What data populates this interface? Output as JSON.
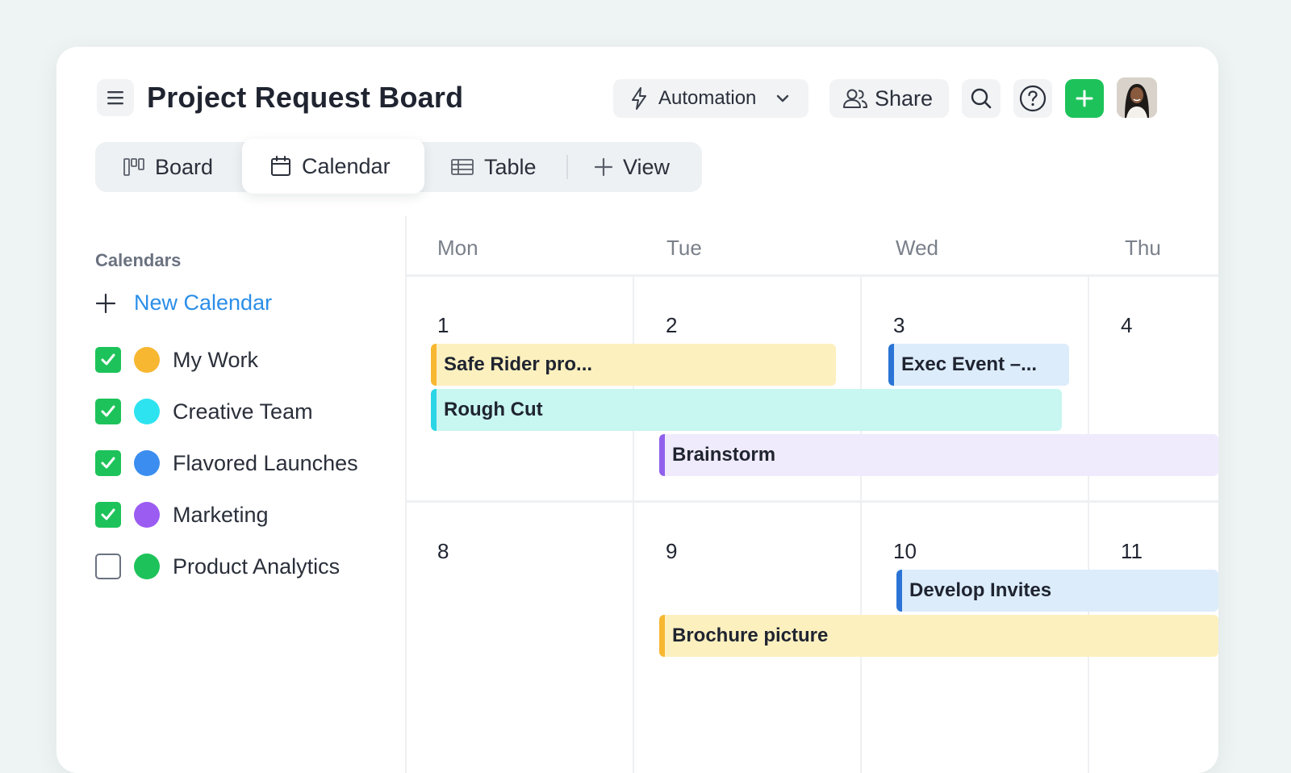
{
  "header": {
    "title": "Project Request Board",
    "automation_label": "Automation",
    "share_label": "Share"
  },
  "tabs": [
    {
      "label": "Board",
      "icon": "board-icon"
    },
    {
      "label": "Calendar",
      "icon": "calendar-icon",
      "active": true
    },
    {
      "label": "Table",
      "icon": "table-icon"
    },
    {
      "label": "View",
      "icon": "plus-icon"
    }
  ],
  "sidebar": {
    "heading": "Calendars",
    "new_calendar_label": "New Calendar",
    "items": [
      {
        "label": "My Work",
        "checked": true,
        "color": "#f7b731"
      },
      {
        "label": "Creative Team",
        "checked": true,
        "color": "#2ee3f0"
      },
      {
        "label": "Flavored Launches",
        "checked": true,
        "color": "#3b8ef0"
      },
      {
        "label": "Marketing",
        "checked": true,
        "color": "#9b5cf2"
      },
      {
        "label": "Product Analytics",
        "checked": false,
        "color": "#1dc35a"
      }
    ]
  },
  "calendar": {
    "days": [
      "Mon",
      "Tue",
      "Wed",
      "Thu"
    ],
    "weeks": [
      [
        "1",
        "2",
        "3",
        "4"
      ],
      [
        "8",
        "9",
        "10",
        "11"
      ]
    ],
    "events": [
      {
        "title": "Safe Rider pro...",
        "color": "yellow"
      },
      {
        "title": "Exec Event –...",
        "color": "blue"
      },
      {
        "title": "Rough Cut",
        "color": "cyan"
      },
      {
        "title": "Brainstorm",
        "color": "purple"
      },
      {
        "title": "Develop Invites",
        "color": "blue"
      },
      {
        "title": "Brochure picture",
        "color": "yellow"
      }
    ]
  },
  "colors": {
    "accent_green": "#1dc35a",
    "link_blue": "#2b8ee8"
  }
}
